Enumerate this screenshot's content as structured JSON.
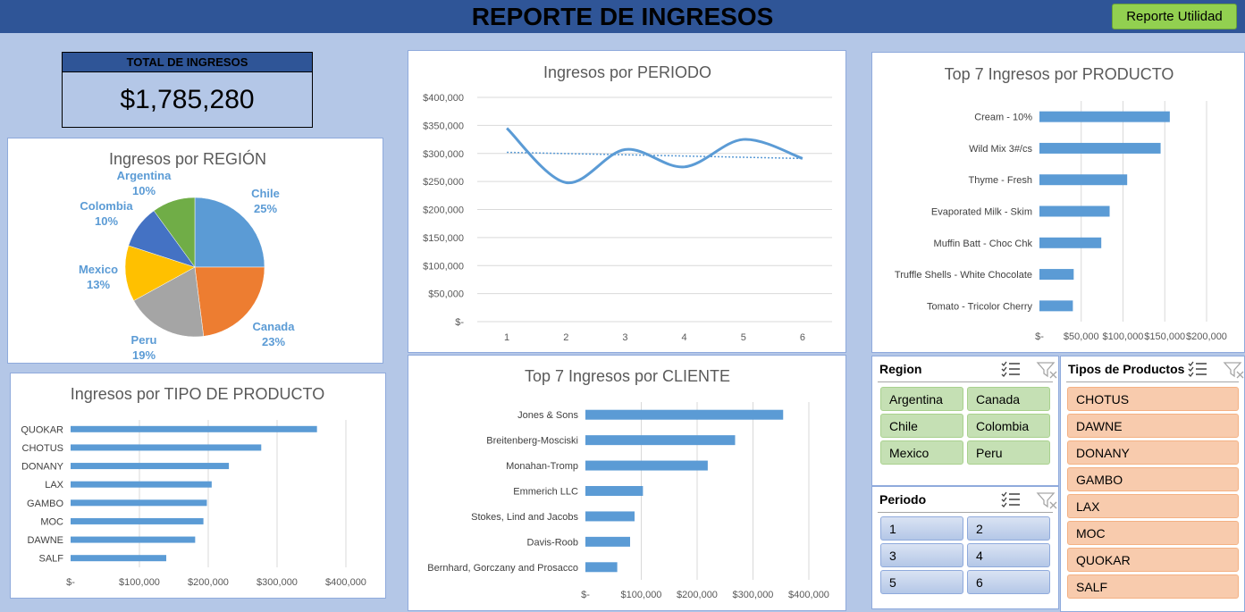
{
  "header": {
    "title": "REPORTE DE INGRESOS",
    "button_label": "Reporte Utilidad"
  },
  "total": {
    "label": "TOTAL DE INGRESOS",
    "value": "$1,785,280"
  },
  "colors": {
    "header_bg": "#2f5597",
    "page_bg": "#b4c7e7",
    "bar": "#5b9bd5",
    "button": "#92d050"
  },
  "chart_data": [
    {
      "id": "region",
      "type": "pie",
      "title": "Ingresos por REGIÓN",
      "slices": [
        {
          "label": "Chile",
          "pct": "25%",
          "value": 25,
          "color": "#5b9bd5"
        },
        {
          "label": "Canada",
          "pct": "23%",
          "value": 23,
          "color": "#ed7d31"
        },
        {
          "label": "Peru",
          "pct": "19%",
          "value": 19,
          "color": "#a5a5a5"
        },
        {
          "label": "Mexico",
          "pct": "13%",
          "value": 13,
          "color": "#ffc000"
        },
        {
          "label": "Colombia",
          "pct": "10%",
          "value": 10,
          "color": "#4472c4"
        },
        {
          "label": "Argentina",
          "pct": "10%",
          "value": 10,
          "color": "#70ad47"
        }
      ]
    },
    {
      "id": "periodo",
      "type": "line",
      "title": "Ingresos por PERIODO",
      "x": [
        1,
        2,
        3,
        4,
        5,
        6
      ],
      "x_ticks": [
        "1",
        "2",
        "3",
        "4",
        "5",
        "6"
      ],
      "values": [
        345000,
        248000,
        307000,
        276000,
        325000,
        291000
      ],
      "trend": [
        302000,
        291000
      ],
      "ylim": [
        0,
        400000
      ],
      "y_ticks": [
        "$-",
        "$50,000",
        "$100,000",
        "$150,000",
        "$200,000",
        "$250,000",
        "$300,000",
        "$350,000",
        "$400,000"
      ],
      "grid": true
    },
    {
      "id": "producto",
      "type": "bar",
      "orientation": "horizontal",
      "title": "Top 7 Ingresos por PRODUCTO",
      "categories": [
        "Cream - 10%",
        "Wild Mix 3#/cs",
        "Thyme - Fresh",
        "Evaporated Milk - Skim",
        "Muffin Batt - Choc Chk",
        "Truffle Shells - White Chocolate",
        "Tomato - Tricolor Cherry"
      ],
      "values": [
        156000,
        145000,
        105000,
        84000,
        74000,
        41000,
        40000
      ],
      "xlim": [
        0,
        200000
      ],
      "x_ticks": [
        "$-",
        "$50,000",
        "$100,000",
        "$150,000",
        "$200,000"
      ]
    },
    {
      "id": "tipo",
      "type": "bar",
      "orientation": "horizontal",
      "title": "Ingresos por TIPO DE PRODUCTO",
      "categories": [
        "QUOKAR",
        "CHOTUS",
        "DONANY",
        "LAX",
        "GAMBO",
        "MOC",
        "DAWNE",
        "SALF"
      ],
      "values": [
        358000,
        277000,
        230000,
        205000,
        198000,
        193000,
        181000,
        139000
      ],
      "xlim": [
        0,
        400000
      ],
      "x_ticks": [
        "$-",
        "$100,000",
        "$200,000",
        "$300,000",
        "$400,000"
      ]
    },
    {
      "id": "cliente",
      "type": "bar",
      "orientation": "horizontal",
      "title": "Top 7 Ingresos por CLIENTE",
      "categories": [
        "Jones & Sons",
        "Breitenberg-Mosciski",
        "Monahan-Tromp",
        "Emmerich LLC",
        "Stokes, Lind and Jacobs",
        "Davis-Roob",
        "Bernhard, Gorczany and Prosacco"
      ],
      "values": [
        354000,
        268000,
        219000,
        103000,
        88000,
        80000,
        57000
      ],
      "xlim": [
        0,
        400000
      ],
      "x_ticks": [
        "$-",
        "$100,000",
        "$200,000",
        "$300,000",
        "$400,000"
      ]
    }
  ],
  "slicers": {
    "region": {
      "title": "Region",
      "items": [
        "Argentina",
        "Canada",
        "Chile",
        "Colombia",
        "Mexico",
        "Peru"
      ]
    },
    "periodo": {
      "title": "Periodo",
      "items": [
        "1",
        "2",
        "3",
        "4",
        "5",
        "6"
      ]
    },
    "tipos": {
      "title": "Tipos de Productos",
      "items": [
        "CHOTUS",
        "DAWNE",
        "DONANY",
        "GAMBO",
        "LAX",
        "MOC",
        "QUOKAR",
        "SALF"
      ]
    }
  }
}
